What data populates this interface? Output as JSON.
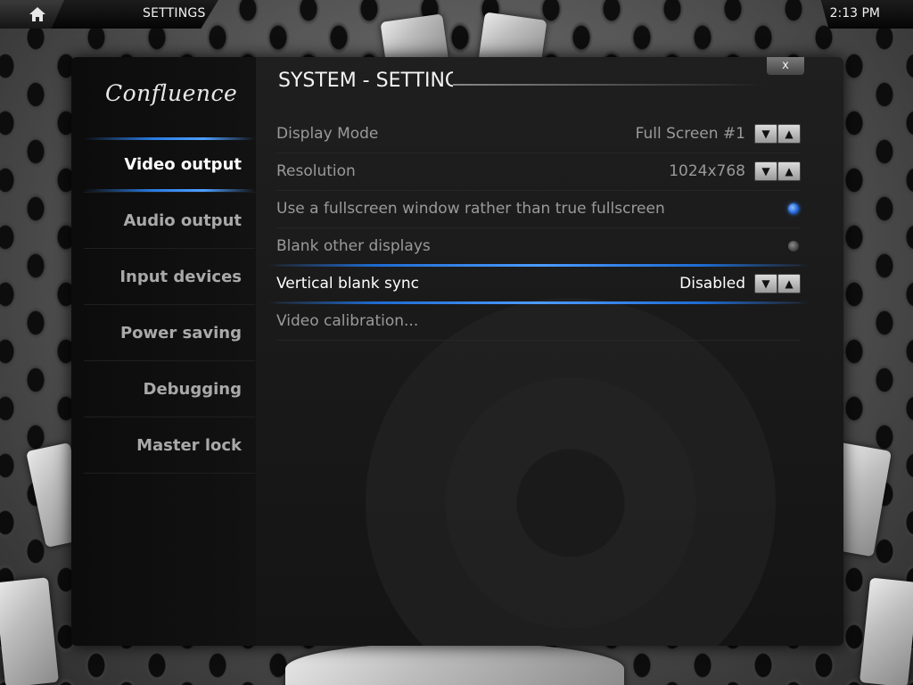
{
  "topbar": {
    "title": "SETTINGS",
    "clock": "2:13 PM",
    "home_icon": "home-icon"
  },
  "sidebar": {
    "logo": "Confluence",
    "items": [
      {
        "label": "Video output",
        "active": true
      },
      {
        "label": "Audio output",
        "active": false
      },
      {
        "label": "Input devices",
        "active": false
      },
      {
        "label": "Power saving",
        "active": false
      },
      {
        "label": "Debugging",
        "active": false
      },
      {
        "label": "Master lock",
        "active": false
      }
    ]
  },
  "panel": {
    "title": "SYSTEM - SETTINGS",
    "close_label": "x",
    "settings": [
      {
        "label": "Display Mode",
        "value": "Full Screen #1",
        "control": "spinner"
      },
      {
        "label": "Resolution",
        "value": "1024x768",
        "control": "spinner"
      },
      {
        "label": "Use a fullscreen window rather than true fullscreen",
        "control": "radio",
        "checked": true
      },
      {
        "label": "Blank other displays",
        "control": "radio",
        "checked": false
      },
      {
        "label": "Vertical blank sync",
        "value": "Disabled",
        "control": "spinner",
        "focused": true
      },
      {
        "label": "Video calibration...",
        "control": "none"
      }
    ],
    "spinner_down": "▼",
    "spinner_up": "▲"
  },
  "colors": {
    "accent_blue": "#2a7ae0",
    "text_active": "#ffffff",
    "text_inactive": "#9a9a9a"
  }
}
